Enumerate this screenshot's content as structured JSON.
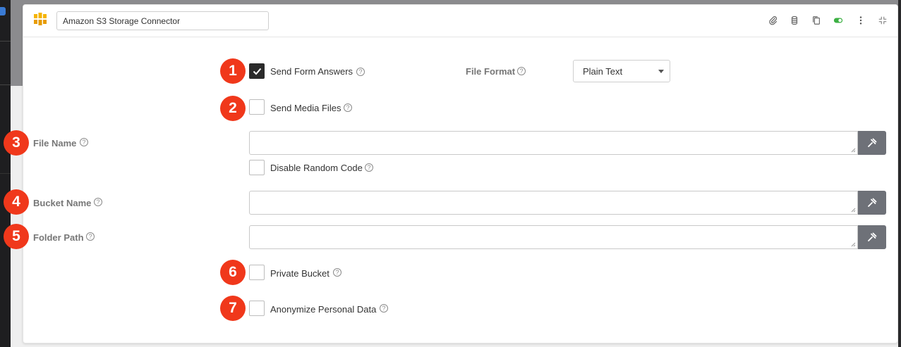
{
  "connector": {
    "title": "Amazon S3 Storage Connector",
    "logo_icon": "aws-s3-icon"
  },
  "header_actions": [
    {
      "name": "attachment-icon"
    },
    {
      "name": "database-icon"
    },
    {
      "name": "copy-icon"
    },
    {
      "name": "toggle-icon"
    },
    {
      "name": "more-vertical-icon"
    },
    {
      "name": "collapse-icon"
    }
  ],
  "markers": [
    "1",
    "2",
    "3",
    "4",
    "5",
    "6",
    "7"
  ],
  "options": {
    "send_form_answers": {
      "label": "Send Form Answers",
      "checked": true
    },
    "send_media_files": {
      "label": "Send Media Files",
      "checked": false
    },
    "disable_random_code": {
      "label": "Disable Random Code",
      "checked": false
    },
    "private_bucket": {
      "label": "Private Bucket",
      "checked": false
    },
    "anonymize_personal_data": {
      "label": "Anonymize Personal Data",
      "checked": false
    }
  },
  "file_format": {
    "label": "File Format",
    "value": "Plain Text"
  },
  "fields": {
    "file_name": {
      "label": "File Name",
      "value": ""
    },
    "bucket_name": {
      "label": "Bucket Name",
      "value": ""
    },
    "folder_path": {
      "label": "Folder Path",
      "value": ""
    }
  },
  "help_glyph": "?",
  "colors": {
    "marker": "#f0381b",
    "toggle_on": "#3cb043",
    "wrench_button": "#6e7178"
  }
}
